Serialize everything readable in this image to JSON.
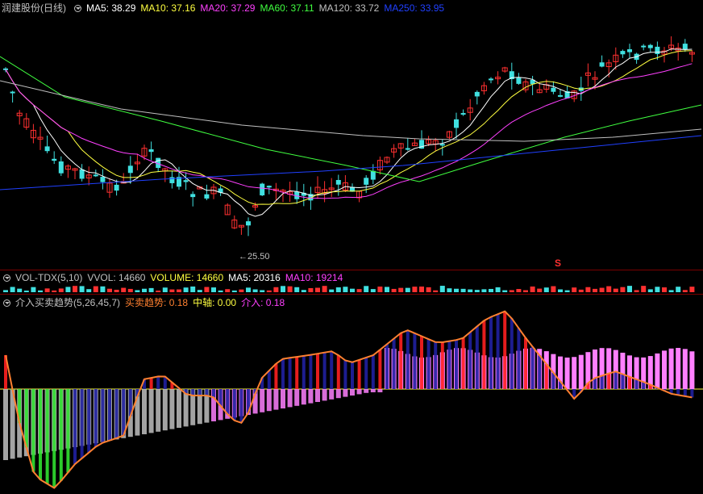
{
  "main_panel": {
    "title": "润建股份(日线)",
    "indicators": [
      {
        "label": "MA5: 38.29",
        "color": "#ffffff"
      },
      {
        "label": "MA10: 37.16",
        "color": "#ffff40"
      },
      {
        "label": "MA20: 37.29",
        "color": "#ff40ff"
      },
      {
        "label": "MA60: 37.11",
        "color": "#40ff40"
      },
      {
        "label": "MA120: 33.72",
        "color": "#c0c0c0"
      },
      {
        "label": "MA250: 33.95",
        "color": "#2040ff"
      }
    ],
    "low_marker": "25.50",
    "signal_symbol": "S"
  },
  "volume_panel": {
    "title": "VOL-TDX(5,10)",
    "indicators": [
      {
        "label": "VVOL: 14660",
        "color": "#c0c0c0"
      },
      {
        "label": "VOLUME: 14660",
        "color": "#ffff40"
      },
      {
        "label": "MA5: 20316",
        "color": "#ffffff"
      },
      {
        "label": "MA10: 19214",
        "color": "#ff40ff"
      }
    ]
  },
  "trend_panel": {
    "title": "介入买卖趋势(5,26,45,7)",
    "indicators": [
      {
        "label": "买卖趋势: 0.18",
        "color": "#ff8030"
      },
      {
        "label": "中轴: 0.00",
        "color": "#ffff40"
      },
      {
        "label": "介入: 0.18",
        "color": "#ff40ff"
      }
    ]
  },
  "colors": {
    "up_candle": "#ff3030",
    "down_candle": "#40e0e0",
    "background": "#000000",
    "separator": "#7a0000"
  }
}
